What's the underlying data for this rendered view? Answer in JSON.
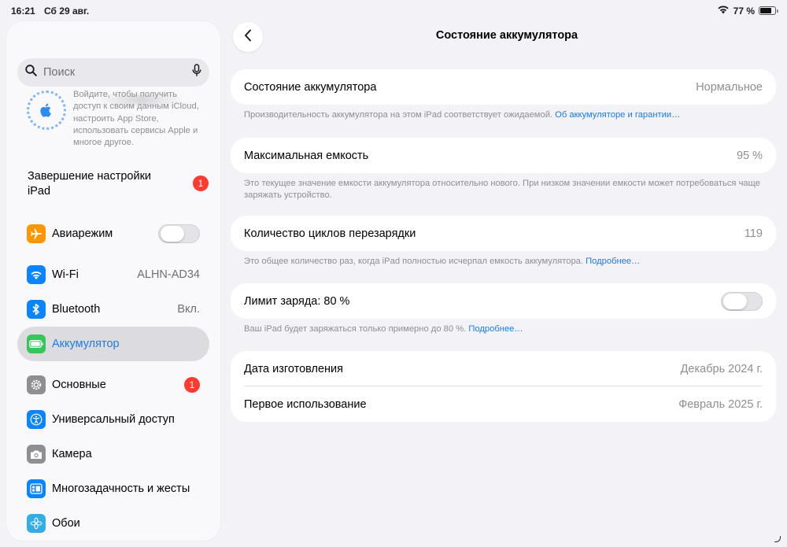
{
  "status_bar": {
    "time": "16:21",
    "date": "Сб 29 авг.",
    "battery_percent": "77 %",
    "battery_level": 0.77
  },
  "sidebar": {
    "search_placeholder": "Поиск",
    "apple_id_text": "Войдите, чтобы получить доступ к своим данным iCloud, настроить App Store, использовать сервисы Apple и многое другое.",
    "setup_label": "Завершение настройки iPad",
    "setup_badge": "1",
    "items": [
      {
        "label": "Авиарежим",
        "icon": "airplane-icon",
        "color": "#ff9500",
        "toggle": false
      },
      {
        "label": "Wi-Fi",
        "icon": "wifi-icon",
        "color": "#0a84ff",
        "value": "ALHN-AD34"
      },
      {
        "label": "Bluetooth",
        "icon": "bluetooth-icon",
        "color": "#0a84ff",
        "value": "Вкл."
      },
      {
        "label": "Аккумулятор",
        "icon": "battery-icon",
        "color": "#34c759",
        "selected": true
      },
      {
        "label": "Основные",
        "icon": "gear-icon",
        "color": "#8e8e93",
        "badge": "1"
      },
      {
        "label": "Универсальный доступ",
        "icon": "accessibility-icon",
        "color": "#0a84ff"
      },
      {
        "label": "Камера",
        "icon": "camera-icon",
        "color": "#8e8e93"
      },
      {
        "label": "Многозадачность и жесты",
        "icon": "multitasking-icon",
        "color": "#0a84ff"
      },
      {
        "label": "Обои",
        "icon": "wallpaper-icon",
        "color": "#32ade6"
      }
    ]
  },
  "main": {
    "title": "Состояние аккумулятора",
    "health": {
      "label": "Состояние аккумулятора",
      "value": "Нормальное",
      "footnote": "Производительность аккумулятора на этом iPad соответствует ожидаемой.",
      "link": "Об аккумуляторе и гарантии…"
    },
    "capacity": {
      "label": "Максимальная емкость",
      "value": "95 %",
      "footnote": "Это текущее значение емкости аккумулятора относительно нового. При низком значении емкости может потребоваться чаще заряжать устройство."
    },
    "cycles": {
      "label": "Количество циклов перезарядки",
      "value": "119",
      "footnote": "Это общее количество раз, когда iPad полностью исчерпал емкость аккумулятора.",
      "link": "Подробнее…"
    },
    "limit": {
      "label": "Лимит заряда: 80 %",
      "toggle_on": false,
      "footnote": "Ваш iPad будет заряжаться только примерно до 80 %.",
      "link": "Подробнее…"
    },
    "dates": {
      "manufacture_label": "Дата изготовления",
      "manufacture_value": "Декабрь 2024 г.",
      "first_use_label": "Первое использование",
      "first_use_value": "Февраль 2025 г."
    }
  },
  "colors": {
    "accent": "#1a7ce9",
    "badge": "#ff3b30"
  }
}
